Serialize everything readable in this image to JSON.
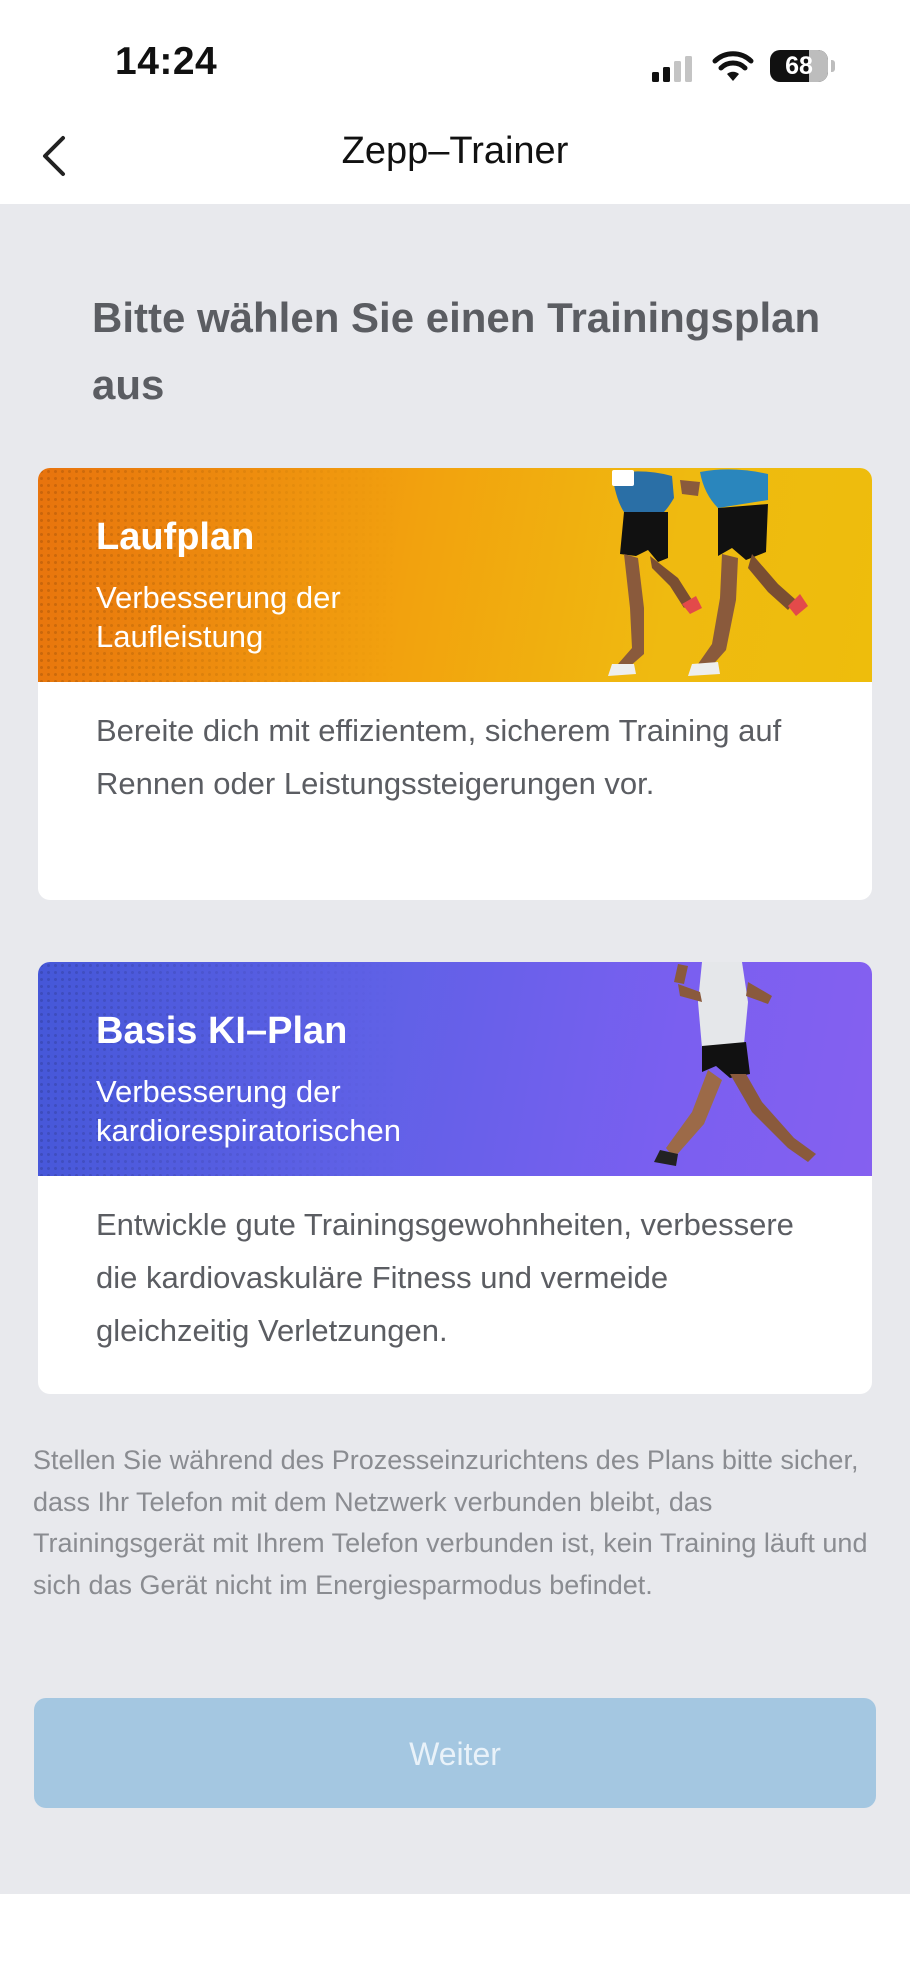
{
  "status_bar": {
    "time": "14:24",
    "battery": "68",
    "battery_level_percent": 68
  },
  "header": {
    "title": "Zepp–Trainer",
    "back_icon": "chevron-left-icon"
  },
  "main": {
    "heading": "Bitte wählen Sie einen Trainingsplan aus",
    "plans": [
      {
        "title": "Laufplan",
        "subtitle": "Verbesserung der Laufleistung",
        "description": "Bereite dich mit effizientem, sicherem Training auf Rennen oder Leistungssteigerungen vor.",
        "banner_color": "#f0a30f"
      },
      {
        "title": "Basis KI–Plan",
        "subtitle": "Verbesserung der kardiorespiratorischen",
        "description": "Entwickle gute Trainingsgewohnheiten, verbessere die kardiovaskuläre Fitness und vermeide gleichzeitig Verletzungen.",
        "banner_color": "#6b5fe9"
      }
    ],
    "note": "Stellen Sie während des Prozesseinzurichtens des Plans bitte sicher, dass Ihr Telefon mit dem Netzwerk verbunden bleibt, das Trainingsgerät mit Ihrem Telefon verbunden ist, kein Training läuft und sich das Gerät nicht im Energiesparmodus befindet.",
    "continue_label": "Weiter"
  },
  "colors": {
    "background": "#e8e9ed",
    "button_disabled": "#a4c7e1"
  }
}
